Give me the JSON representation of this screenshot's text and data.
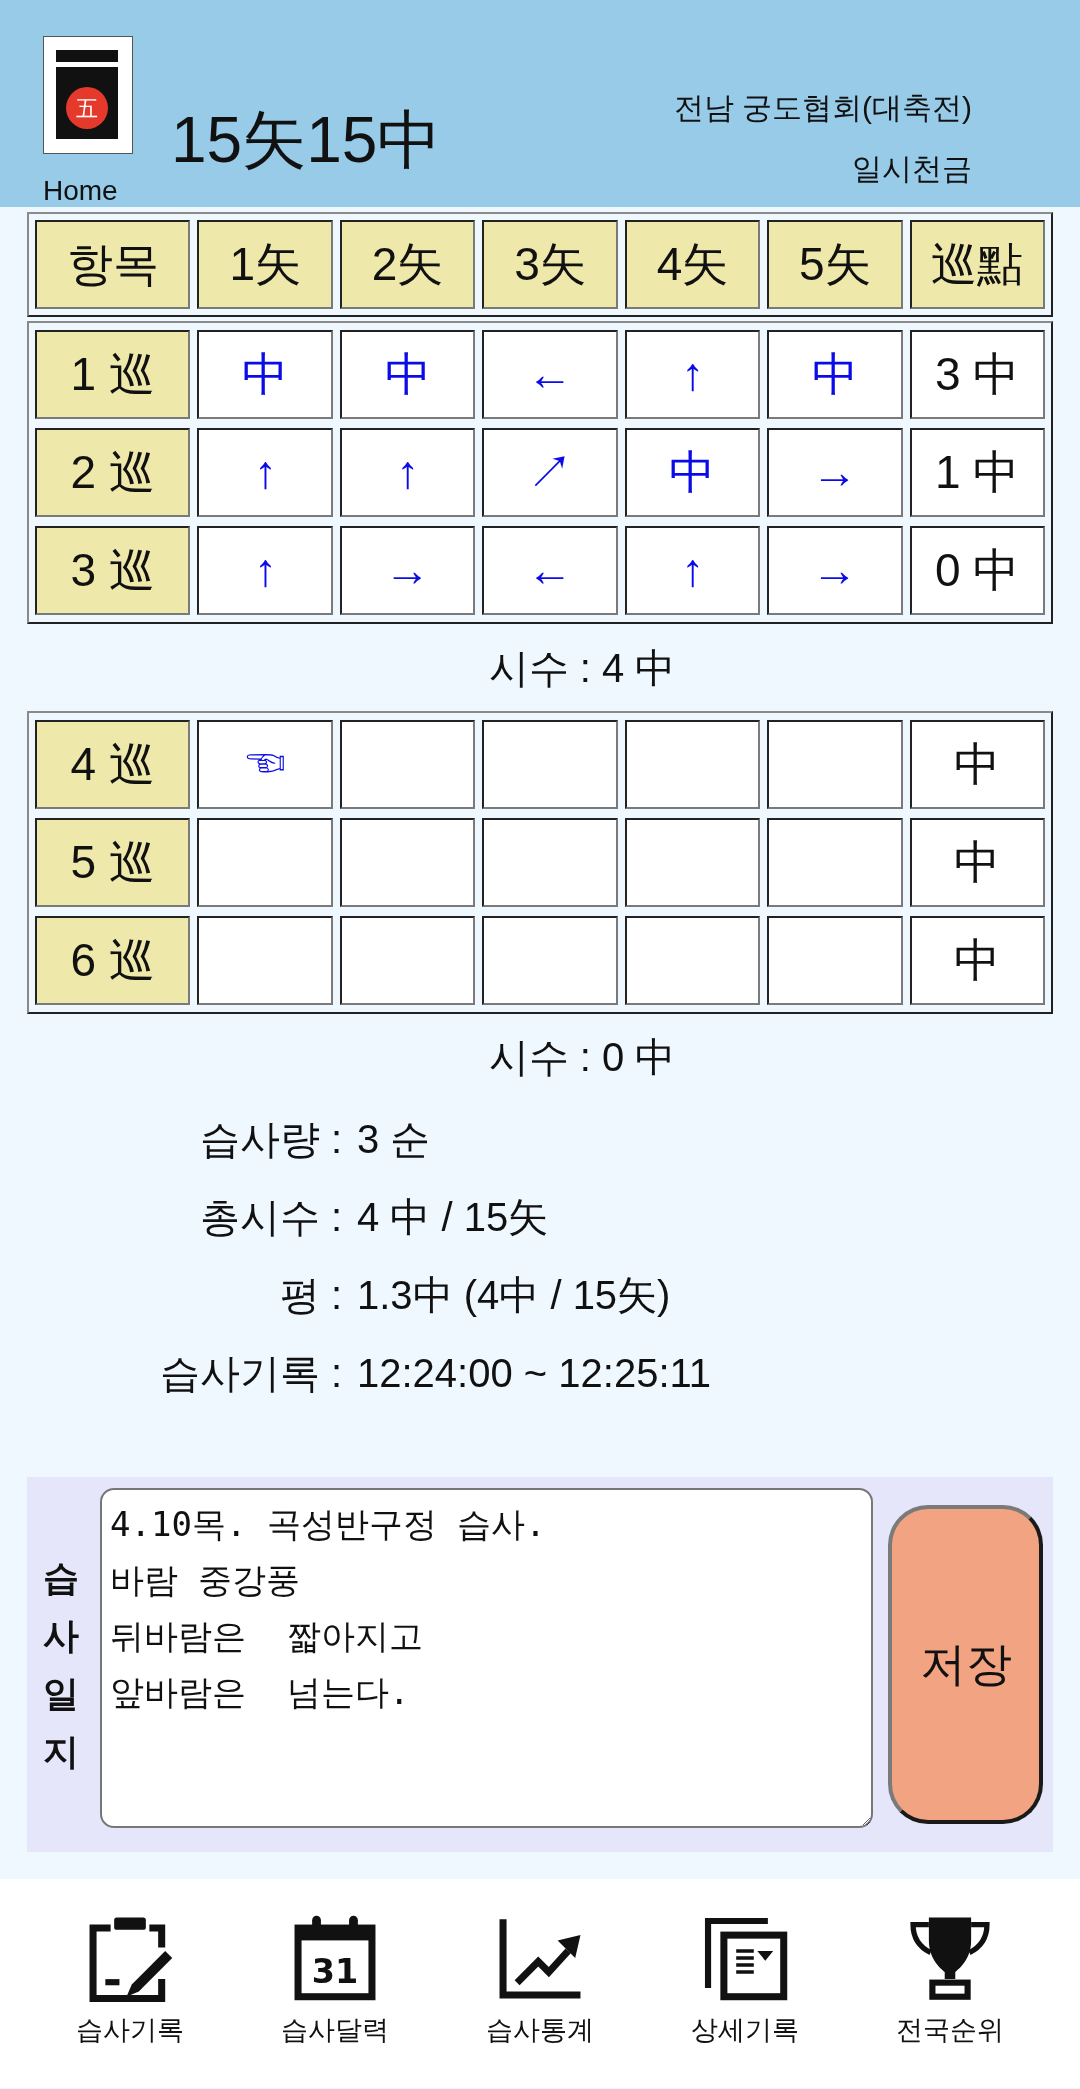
{
  "header": {
    "logo": {
      "glyph": "五"
    },
    "home_link": "Home",
    "title": "15矢15中",
    "association": "전남 궁도협회(대축전)",
    "motto": "일시천금"
  },
  "score_table": {
    "columns": [
      "항목",
      "1矢",
      "2矢",
      "3矢",
      "4矢",
      "5矢",
      "巡點"
    ]
  },
  "round_groups": [
    {
      "rows": [
        {
          "label": "1 巡",
          "shots": [
            "中",
            "中",
            "←",
            "↑",
            "中"
          ],
          "total": "3 中"
        },
        {
          "label": "2 巡",
          "shots": [
            "↑",
            "↑",
            "↗",
            "中",
            "→"
          ],
          "total": "1 中"
        },
        {
          "label": "3 巡",
          "shots": [
            "↑",
            "→",
            "←",
            "↑",
            "→"
          ],
          "total": "0 中"
        }
      ],
      "subtotal": "시수 : 4 中"
    },
    {
      "rows": [
        {
          "label": "4 巡",
          "shots": [
            "☜"
          ],
          "total": "中"
        },
        {
          "label": "5 巡",
          "total": "中"
        },
        {
          "label": "6 巡",
          "total": "中"
        }
      ],
      "subtotal": "시수 : 0 中"
    }
  ],
  "stats": [
    {
      "label": "습사량 :",
      "value": "3 순"
    },
    {
      "label": "총시수 :",
      "value": "4 中 / 15矢"
    },
    {
      "label": "평 :",
      "value": "1.3中 (4中 / 15矢)"
    },
    {
      "label": "습사기록 :",
      "value": "12:24:00 ~ 12:25:11"
    }
  ],
  "journal": {
    "label": "습사일지",
    "value": "4.10목. 곡성반구정 습사.\n바람 중강풍\n뒤바람은  짧아지고\n앞바람은  넘는다.",
    "save_button": "저장"
  },
  "bottom_nav": [
    {
      "kind": "record",
      "label": "습사기록"
    },
    {
      "kind": "calendar",
      "day": "31",
      "label": "습사달력"
    },
    {
      "kind": "stats",
      "label": "습사통계"
    },
    {
      "kind": "details",
      "label": "상세기록"
    },
    {
      "kind": "ranking",
      "label": "전국순위"
    }
  ]
}
